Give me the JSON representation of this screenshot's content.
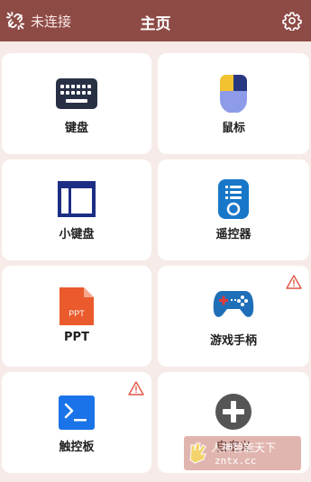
{
  "header": {
    "connection_status": "未连接",
    "title": "主页"
  },
  "cards": [
    {
      "label": "键盘",
      "icon": "keyboard-icon"
    },
    {
      "label": "鼠标",
      "icon": "mouse-icon"
    },
    {
      "label": "小键盘",
      "icon": "numpad-icon"
    },
    {
      "label": "遥控器",
      "icon": "remote-control-icon"
    },
    {
      "label": "PPT",
      "icon": "ppt-icon",
      "icon_text": "PPT"
    },
    {
      "label": "游戏手柄",
      "icon": "gamepad-icon",
      "warning": true
    },
    {
      "label": "触控板",
      "icon": "terminal-icon",
      "warning": true
    },
    {
      "label": "自定义",
      "icon": "plus-circle-icon"
    }
  ],
  "watermark": {
    "line1": "人神智能天下",
    "line2": "zntx.cc"
  },
  "colors": {
    "header_bg": "#8e4b46",
    "page_bg": "#f6ebe8",
    "keyboard": "#283046",
    "mouse_yellow": "#f2c230",
    "mouse_blue": "#8d9be8",
    "numpad": "#1c2e84",
    "remote": "#1877c8",
    "ppt": "#ea5a2d",
    "gamepad": "#1f6fb8",
    "terminal": "#1a73e8",
    "plus": "#555555",
    "warning": "#e05545"
  }
}
